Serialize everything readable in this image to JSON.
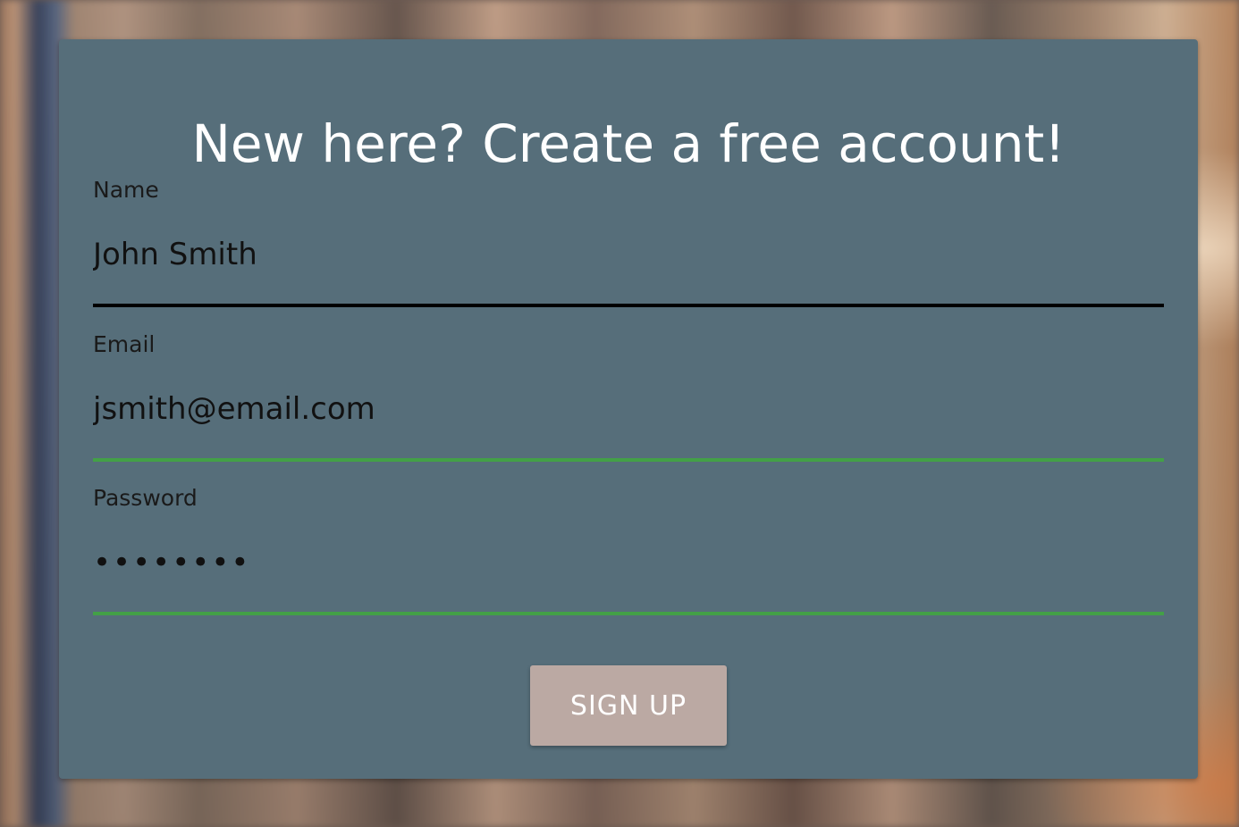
{
  "form": {
    "title": "New here? Create a free account!",
    "name_label": "Name",
    "name_value": "John Smith",
    "email_label": "Email",
    "email_value": "jsmith@email.com",
    "password_label": "Password",
    "password_value": "••••••••",
    "signup_label": "SIGN UP"
  },
  "colors": {
    "card": "#566e7a",
    "valid_underline": "#43a047",
    "focused_underline": "#000000",
    "button": "#bba9a3"
  }
}
